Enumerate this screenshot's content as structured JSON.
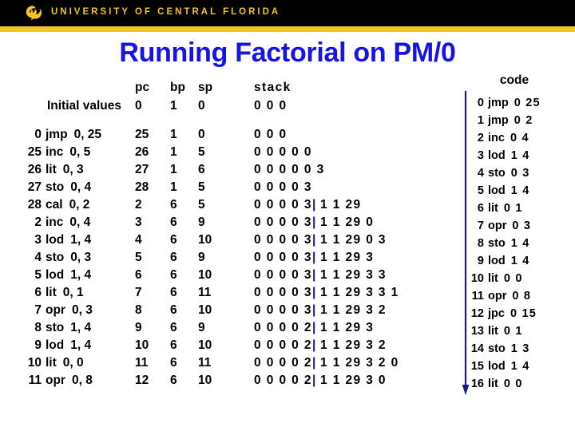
{
  "header": {
    "wordmark": "UNIVERSITY OF CENTRAL FLORIDA",
    "logo_icon": "ucf-pegasus-icon",
    "bar_color": "#000000",
    "stripe_color": "#f5c425",
    "wordmark_color": "#f3c41f"
  },
  "title": {
    "text": "Running Factorial on PM/0",
    "color": "#1414e6"
  },
  "trace": {
    "columns": {
      "instruction": "",
      "pc": "pc",
      "bp": "bp",
      "sp": "sp",
      "stack": "stack"
    },
    "initial": {
      "label": "Initial values",
      "pc": "0",
      "bp": "1",
      "sp": "0",
      "stack": "0 0 0"
    },
    "rows": [
      {
        "addr": "0",
        "mnemonic": "jmp",
        "operands": "0, 25",
        "pc": "25",
        "bp": "1",
        "sp": "0",
        "stack_left": "0 0 0",
        "stack_bar": "",
        "stack_right": ""
      },
      {
        "addr": "25",
        "mnemonic": "inc",
        "operands": "0, 5",
        "pc": "26",
        "bp": "1",
        "sp": "5",
        "stack_left": "0 0 0 0 0",
        "stack_bar": "",
        "stack_right": ""
      },
      {
        "addr": "26",
        "mnemonic": "lit",
        "operands": "0, 3",
        "pc": "27",
        "bp": "1",
        "sp": "6",
        "stack_left": "0 0 0 0 0 3",
        "stack_bar": "",
        "stack_right": ""
      },
      {
        "addr": "27",
        "mnemonic": "sto",
        "operands": "0, 4",
        "pc": "28",
        "bp": "1",
        "sp": "5",
        "stack_left": "0 0 0 0 3",
        "stack_bar": "",
        "stack_right": ""
      },
      {
        "addr": "28",
        "mnemonic": "cal",
        "operands": "0, 2",
        "pc": "2",
        "bp": "6",
        "sp": "5",
        "stack_left": "0 0 0 0 3",
        "stack_bar": "|",
        "stack_right": "1 1 29"
      },
      {
        "addr": "2",
        "mnemonic": "inc",
        "operands": "0, 4",
        "pc": "3",
        "bp": "6",
        "sp": "9",
        "stack_left": "0 0 0 0 3",
        "stack_bar": "|",
        "stack_right": "1 1 29 0"
      },
      {
        "addr": "3",
        "mnemonic": "lod",
        "operands": "1, 4",
        "pc": "4",
        "bp": "6",
        "sp": "10",
        "stack_left": "0 0 0 0 3",
        "stack_bar": "|",
        "stack_right": "1 1 29 0 3"
      },
      {
        "addr": "4",
        "mnemonic": "sto",
        "operands": "0, 3",
        "pc": "5",
        "bp": "6",
        "sp": "9",
        "stack_left": "0 0 0 0 3",
        "stack_bar": "|",
        "stack_right": "1 1 29 3"
      },
      {
        "addr": "5",
        "mnemonic": "lod",
        "operands": "1, 4",
        "pc": "6",
        "bp": "6",
        "sp": "10",
        "stack_left": "0 0 0 0 3",
        "stack_bar": "|",
        "stack_right": "1 1 29 3 3"
      },
      {
        "addr": "6",
        "mnemonic": "lit",
        "operands": "0, 1",
        "pc": "7",
        "bp": "6",
        "sp": "11",
        "stack_left": "0 0 0 0 3",
        "stack_bar": "|",
        "stack_right": "1 1 29 3 3 1"
      },
      {
        "addr": "7",
        "mnemonic": "opr",
        "operands": "0, 3",
        "pc": "8",
        "bp": "6",
        "sp": "10",
        "stack_left": "0 0 0 0 3",
        "stack_bar": "|",
        "stack_right": "1 1 29 3 2"
      },
      {
        "addr": "8",
        "mnemonic": "sto",
        "operands": "1, 4",
        "pc": "9",
        "bp": "6",
        "sp": "9",
        "stack_left": "0 0 0 0 2",
        "stack_bar": "|",
        "stack_right": "1 1 29 3"
      },
      {
        "addr": "9",
        "mnemonic": "lod",
        "operands": "1, 4",
        "pc": "10",
        "bp": "6",
        "sp": "10",
        "stack_left": "0 0 0 0 2",
        "stack_bar": "|",
        "stack_right": "1 1 29 3 2"
      },
      {
        "addr": "10",
        "mnemonic": "lit",
        "operands": "0, 0",
        "pc": "11",
        "bp": "6",
        "sp": "11",
        "stack_left": "0 0 0 0 2",
        "stack_bar": "|",
        "stack_right": "1 1 29 3 2 0"
      },
      {
        "addr": "11",
        "mnemonic": "opr",
        "operands": "0, 8",
        "pc": "12",
        "bp": "6",
        "sp": "10",
        "stack_left": "0 0 0 0 2",
        "stack_bar": "|",
        "stack_right": "1 1 29 3 0"
      }
    ]
  },
  "code": {
    "title": "code",
    "arrow_icon": "down-arrow-icon",
    "arrow_color": "#1a1a8c",
    "rows": [
      {
        "addr": "0",
        "mnemonic": "jmp",
        "operands": "0 25"
      },
      {
        "addr": "1",
        "mnemonic": "jmp",
        "operands": "0 2"
      },
      {
        "addr": "2",
        "mnemonic": "inc",
        "operands": "0 4"
      },
      {
        "addr": "3",
        "mnemonic": "lod",
        "operands": "1 4"
      },
      {
        "addr": "4",
        "mnemonic": "sto",
        "operands": "0 3"
      },
      {
        "addr": "5",
        "mnemonic": "lod",
        "operands": "1 4"
      },
      {
        "addr": "6",
        "mnemonic": "lit",
        "operands": "0 1"
      },
      {
        "addr": "7",
        "mnemonic": "opr",
        "operands": "0 3"
      },
      {
        "addr": "8",
        "mnemonic": "sto",
        "operands": "1 4"
      },
      {
        "addr": "9",
        "mnemonic": "lod",
        "operands": "1 4"
      },
      {
        "addr": "10",
        "mnemonic": "lit",
        "operands": "0 0"
      },
      {
        "addr": "11",
        "mnemonic": "opr",
        "operands": "0 8"
      },
      {
        "addr": "12",
        "mnemonic": "jpc",
        "operands": "0 15"
      },
      {
        "addr": "13",
        "mnemonic": "lit",
        "operands": "0 1"
      },
      {
        "addr": "14",
        "mnemonic": "sto",
        "operands": "1 3"
      },
      {
        "addr": "15",
        "mnemonic": "lod",
        "operands": "1 4"
      },
      {
        "addr": "16",
        "mnemonic": "lit",
        "operands": "0 0"
      }
    ]
  }
}
